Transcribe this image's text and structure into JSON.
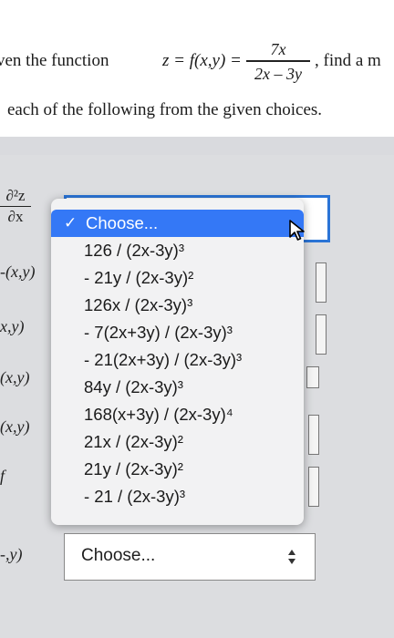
{
  "question": {
    "intro": "ven the function",
    "function_lhs": "z = f(x,y) =",
    "fraction_numerator": "7x",
    "fraction_denominator": "2x – 3y",
    "after": ", find a m",
    "line2": "each of the following from the given choices."
  },
  "left_labels": {
    "first_top": "∂²z",
    "first_bottom": "∂x",
    "row2": "-(x,y)",
    "row3": "x,y)",
    "row4": "(x,y)",
    "row5": "(x,y)",
    "row6_top": "f",
    "row7": "-,y)"
  },
  "dropdown": {
    "options": [
      {
        "label": "Choose...",
        "selected": true
      },
      {
        "label": "126 / (2x-3y)³"
      },
      {
        "label": "- 21y / (2x-3y)²"
      },
      {
        "label": "126x / (2x-3y)³"
      },
      {
        "label": "- 7(2x+3y) / (2x-3y)³"
      },
      {
        "label": "- 21(2x+3y) / (2x-3y)³"
      },
      {
        "label": "84y / (2x-3y)³"
      },
      {
        "label": "168(x+3y) / (2x-3y)⁴"
      },
      {
        "label": "21x / (2x-3y)²"
      },
      {
        "label": "21y / (2x-3y)²"
      },
      {
        "label": "- 21 / (2x-3y)³"
      }
    ],
    "check_glyph": "✓"
  },
  "bottom_select": {
    "value": "Choose..."
  },
  "colors": {
    "accent": "#3478f6",
    "focus_border": "#2b74d6",
    "background": "#dcdde0"
  }
}
